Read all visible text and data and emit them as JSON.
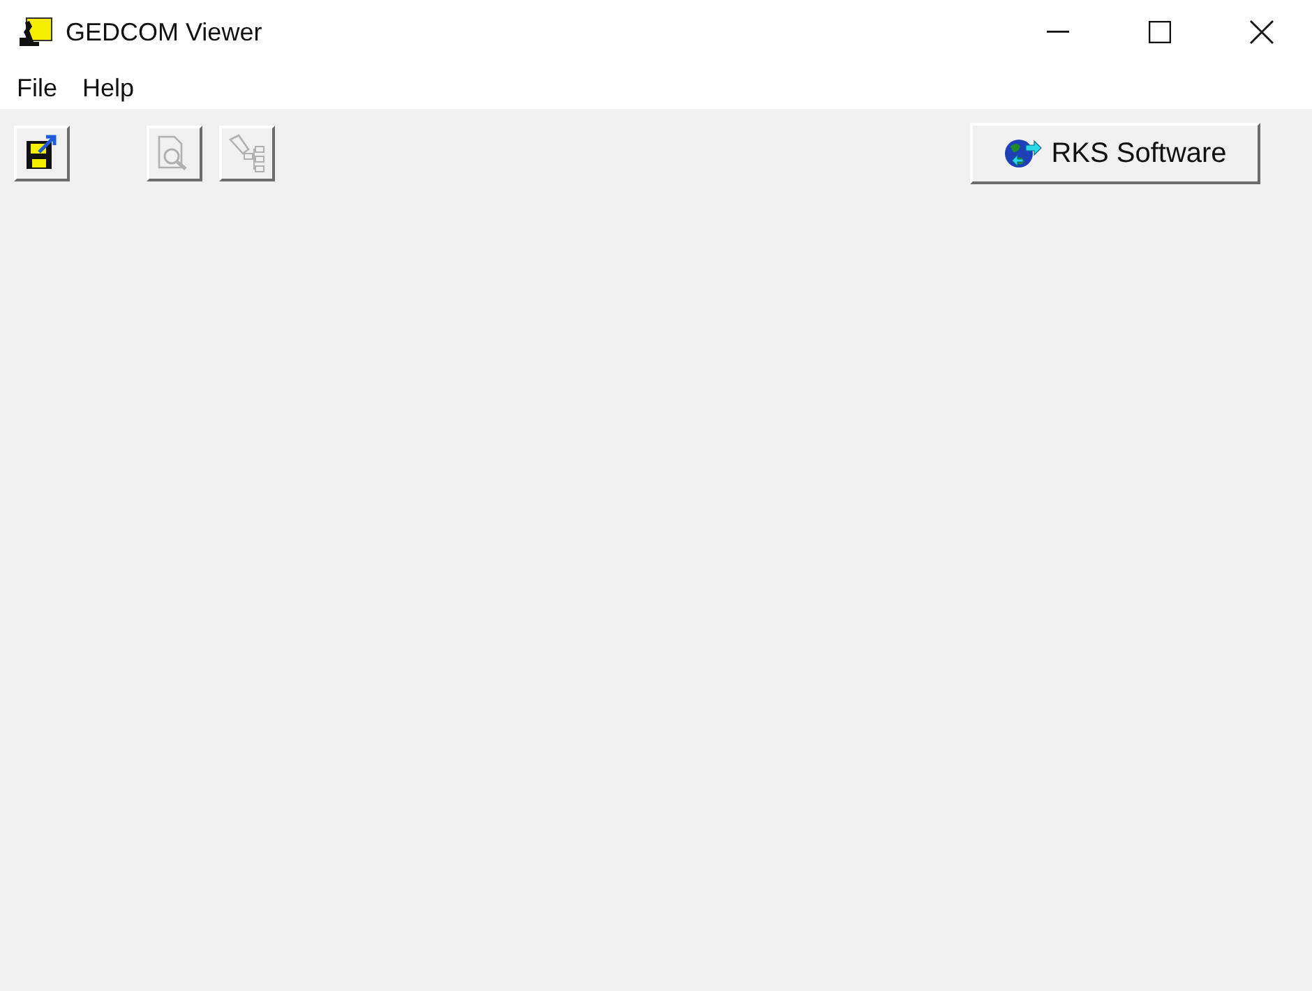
{
  "window": {
    "title": "GEDCOM Viewer"
  },
  "menu": [
    "File",
    "Help"
  ],
  "toolbar": [
    {
      "kind": "save",
      "disabled": false
    },
    {
      "kind": "preview",
      "disabled": true
    },
    {
      "kind": "tree",
      "disabled": true
    }
  ],
  "link_button": {
    "label": "RKS Software"
  }
}
